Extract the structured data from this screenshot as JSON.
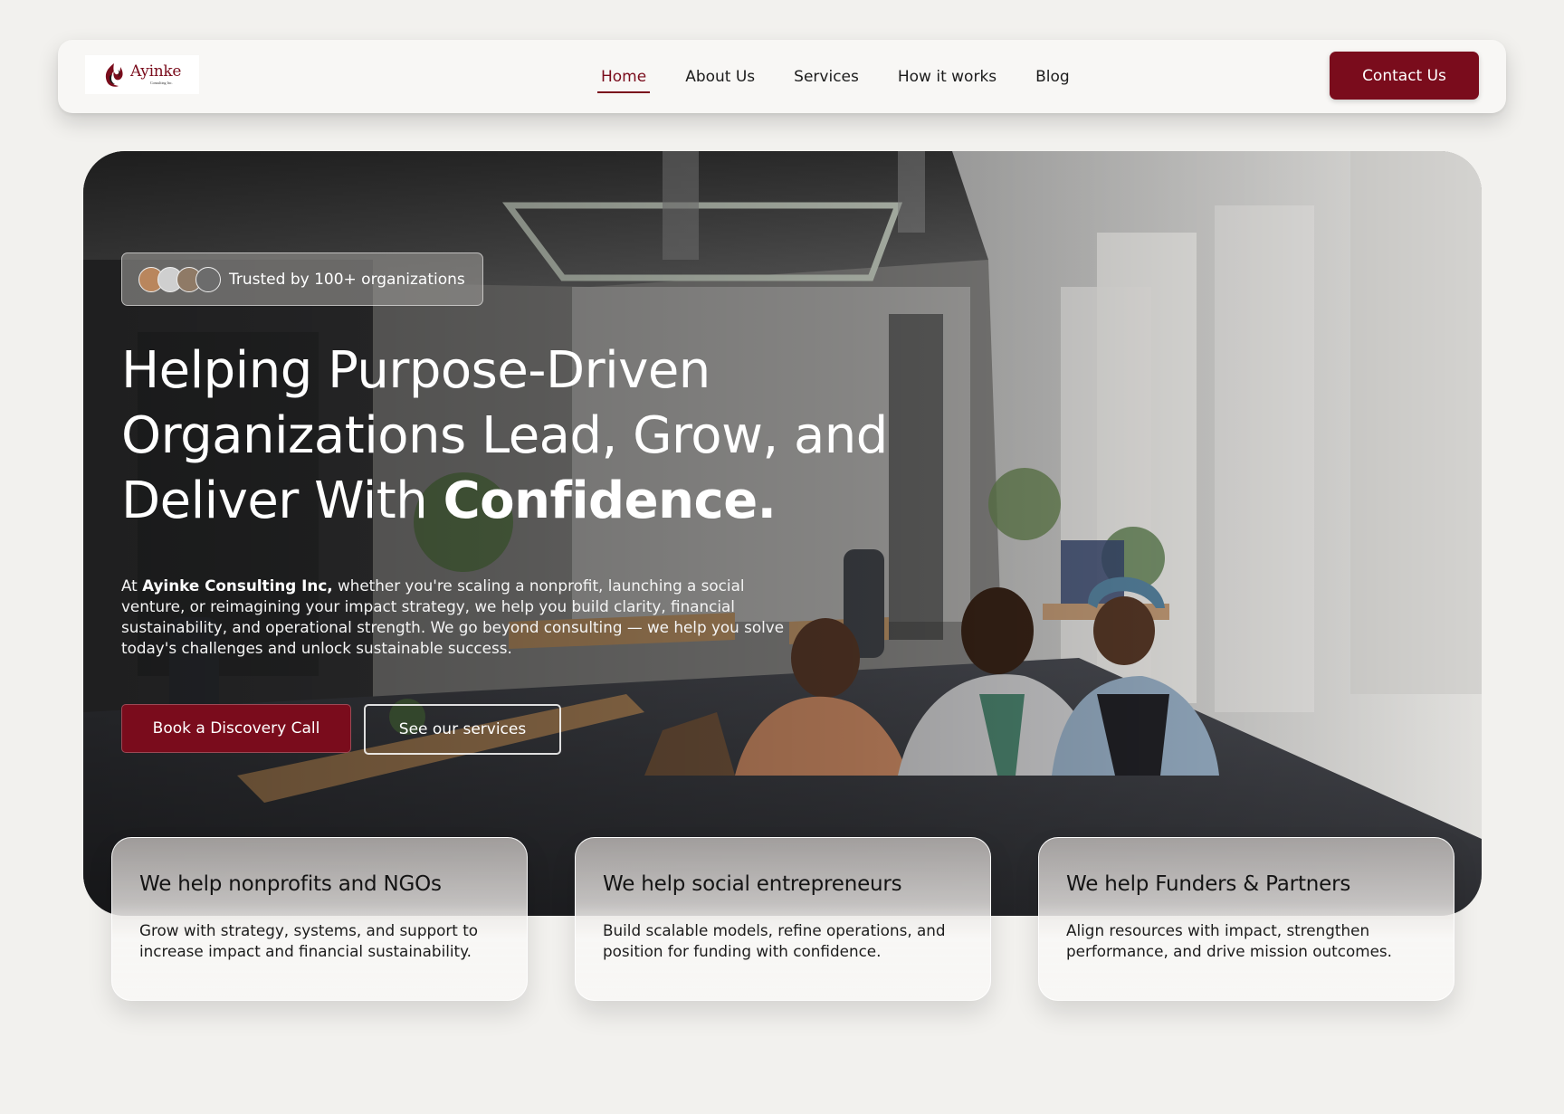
{
  "brand": {
    "logo_name": "Ayinke",
    "logo_sub": "Consulting Inc.",
    "accent": "#7a0c1c"
  },
  "nav": {
    "items": [
      {
        "label": "Home",
        "active": true
      },
      {
        "label": "About Us",
        "active": false
      },
      {
        "label": "Services",
        "active": false
      },
      {
        "label": "How it works",
        "active": false
      },
      {
        "label": "Blog",
        "active": false
      }
    ],
    "contact_label": "Contact Us"
  },
  "hero": {
    "trusted_text": "Trusted by 100+ organizations",
    "title_line1": "Helping Purpose-Driven",
    "title_line2": "Organizations Lead, Grow, and",
    "title_line3_prefix": "Deliver With ",
    "title_line3_bold": "Confidence.",
    "desc_prefix": "At ",
    "desc_company": "Ayinke Consulting Inc,",
    "desc_rest": " whether you're scaling a nonprofit, launching a social venture, or reimagining your impact strategy, we help you build clarity, financial sustainability, and operational strength. We go beyond consulting — we help you solve today's challenges and unlock sustainable success.",
    "primary_cta": "Book a Discovery Call",
    "secondary_cta": "See our services"
  },
  "cards": [
    {
      "title": "We help nonprofits and NGOs",
      "text": "Grow with strategy, systems, and support to increase impact and financial sustainability."
    },
    {
      "title": "We help social entrepreneurs",
      "text": "Build scalable models, refine operations, and position for funding with confidence."
    },
    {
      "title": "We help Funders & Partners",
      "text": "Align resources with impact, strengthen performance, and drive mission outcomes."
    }
  ]
}
